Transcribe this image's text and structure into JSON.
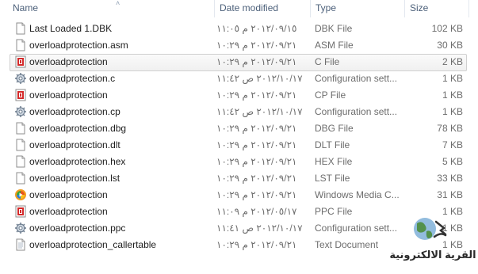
{
  "columns": {
    "name": "Name",
    "date": "Date modified",
    "type": "Type",
    "size": "Size"
  },
  "rows": [
    {
      "name": "Last Loaded 1.DBK",
      "date": "٢٠١٢/٠٩/١٥ م ١١:٠٥",
      "type": "DBK File",
      "size": "102 KB",
      "icon": "document-icon"
    },
    {
      "name": "overloadprotection.asm",
      "date": "٢٠١٢/٠٩/٢١ م ١٠:٢٩",
      "type": "ASM File",
      "size": "30 KB",
      "icon": "document-icon"
    },
    {
      "name": "overloadprotection",
      "date": "٢٠١٢/٠٩/٢١ م ١٠:٢٩",
      "type": "C File",
      "size": "2 KB",
      "icon": "red-source-file-icon",
      "selected": true
    },
    {
      "name": "overloadprotection.c",
      "date": "٢٠١٢/١٠/١٧ ص ١١:٤٢",
      "type": "Configuration sett...",
      "size": "1 KB",
      "icon": "config-gear-icon"
    },
    {
      "name": "overloadprotection",
      "date": "٢٠١٢/٠٩/٢١ م ١٠:٢٩",
      "type": "CP File",
      "size": "1 KB",
      "icon": "red-source-file-icon"
    },
    {
      "name": "overloadprotection.cp",
      "date": "٢٠١٢/١٠/١٧ ص ١١:٤٢",
      "type": "Configuration sett...",
      "size": "1 KB",
      "icon": "config-gear-icon"
    },
    {
      "name": "overloadprotection.dbg",
      "date": "٢٠١٢/٠٩/٢١ م ١٠:٢٩",
      "type": "DBG File",
      "size": "78 KB",
      "icon": "document-icon"
    },
    {
      "name": "overloadprotection.dlt",
      "date": "٢٠١٢/٠٩/٢١ م ١٠:٢٩",
      "type": "DLT File",
      "size": "7 KB",
      "icon": "document-icon"
    },
    {
      "name": "overloadprotection.hex",
      "date": "٢٠١٢/٠٩/٢١ م ١٠:٢٩",
      "type": "HEX File",
      "size": "5 KB",
      "icon": "document-icon"
    },
    {
      "name": "overloadprotection.lst",
      "date": "٢٠١٢/٠٩/٢١ م ١٠:٢٩",
      "type": "LST File",
      "size": "33 KB",
      "icon": "document-icon"
    },
    {
      "name": "overloadprotection",
      "date": "٢٠١٢/٠٩/٢١ م ١٠:٢٩",
      "type": "Windows Media C...",
      "size": "31 KB",
      "icon": "windows-media-icon"
    },
    {
      "name": "overloadprotection",
      "date": "٢٠١٢/٠٥/١٧ م ١١:٠٩",
      "type": "PPC File",
      "size": "1 KB",
      "icon": "red-source-file-icon"
    },
    {
      "name": "overloadprotection.ppc",
      "date": "٢٠١٢/١٠/١٧ ص ١١:٤١",
      "type": "Configuration sett...",
      "size": "1 KB",
      "icon": "config-gear-icon"
    },
    {
      "name": "overloadprotection_callertable",
      "date": "٢٠١٢/٠٩/٢١ م ١٠:٢٩",
      "type": "Text Document",
      "size": "1 KB",
      "icon": "text-document-icon"
    }
  ],
  "watermark": {
    "text": "القرية الالكترونية",
    "icon": "globe-logo-icon"
  },
  "colors": {
    "header_text": "#4c607a",
    "secondary_text": "#6d6d6d",
    "selection_border": "#d0d0d0"
  }
}
